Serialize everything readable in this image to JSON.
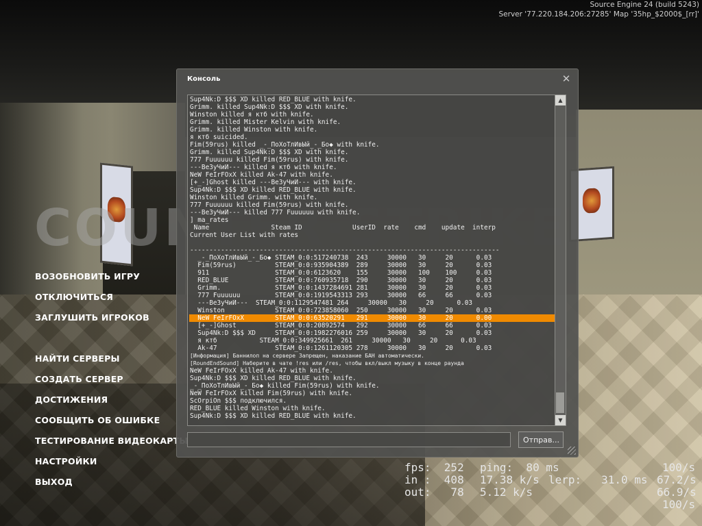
{
  "engine": {
    "version": "Source Engine 24 (build 5243)",
    "server": "Server '77.220.184.206:27285' Map '35hp_$2000$_[rr]'"
  },
  "menu": {
    "items": [
      {
        "label": "ВОЗОБНОВИТЬ ИГРУ"
      },
      {
        "label": "ОТКЛЮЧИТЬСЯ"
      },
      {
        "label": "ЗАГЛУШИТЬ ИГРОКОВ"
      },
      {
        "label": "НАЙТИ СЕРВЕРЫ"
      },
      {
        "label": "СОЗДАТЬ СЕРВЕР"
      },
      {
        "label": "ДОСТИЖЕНИЯ"
      },
      {
        "label": "СООБЩИТЬ ОБ ОШИБКЕ"
      },
      {
        "label": "ТЕСТИРОВАНИЕ ВИДЕОКАРТЫ"
      },
      {
        "label": "НАСТРОЙКИ"
      },
      {
        "label": "ВЫХОД"
      }
    ]
  },
  "console": {
    "title": "Консоль",
    "submit_label": "Отправ...",
    "input_value": "",
    "lines": [
      {
        "text": "Sup4Nk:D $$$ XD killed RED_BLUE with knife."
      },
      {
        "text": "Grimm. killed Sup4Nk:D $$$ XD with knife."
      },
      {
        "text": "Winston killed я ктб with knife."
      },
      {
        "text": "Grimm. killed Mister Kelvin with knife."
      },
      {
        "text": "Grimm. killed Winston with knife."
      },
      {
        "text": "я ктб suicided."
      },
      {
        "text": "Fim(59rus) killed _-_ПоХоТлИвЫй_-_Бо◆ with knife."
      },
      {
        "text": "Grimm. killed Sup4Nk:D $$$ XD with knife."
      },
      {
        "text": "777 Fuuuuuu killed Fim(59rus) with knife."
      },
      {
        "text": "---ВеЗуЧиЙ--- killed я ктб with knife."
      },
      {
        "text": "NeW FeIrFOxX killed Ak-47 with knife."
      },
      {
        "text": "[+_-]Ghost killed ---ВеЗуЧиЙ--- with knife."
      },
      {
        "text": "Sup4Nk:D $$$ XD killed RED_BLUE with knife."
      },
      {
        "text": "Winston killed Grimm. with knife."
      },
      {
        "text": "777 Fuuuuuu killed Fim(59rus) with knife."
      },
      {
        "text": "---ВеЗуЧиЙ--- killed 777 Fuuuuuu with knife."
      },
      {
        "text": "] ma_rates"
      },
      {
        "text": " Name                Steam ID             UserID  rate    cmd    update  interp"
      },
      {
        "text": "Current User List with rates"
      },
      {
        "text": ""
      },
      {
        "text": "--------------------------------------------------------------------------------"
      },
      {
        "text": "  _-_ПоХоТлИвЫй_-_Бо◆ STEAM_0:0:517240738  243     30000   30     20      0.03"
      },
      {
        "text": "  Fim(59rus)          STEAM_0:0:935904389  289     30000   30     20      0.03"
      },
      {
        "text": "  911                 STEAM_0:0:6123620    155     30000   100    100     0.03"
      },
      {
        "text": "  RED_BLUE            STEAM_0:0:760935718  290     30000   30     20      0.03"
      },
      {
        "text": "  Grimm.              STEAM_0:0:1437284691 281     30000   30     20      0.03"
      },
      {
        "text": "  777 Fuuuuuu         STEAM_0:0:1919543313 293     30000   66     66      0.03"
      },
      {
        "text": "  ---ВеЗуЧиЙ---  STEAM_0:0:1129547481 264     30000   30     20      0.03"
      },
      {
        "text": "  Winston             STEAM_0:0:723858060  250     30000   30     20      0.03"
      },
      {
        "text": "  NeW FeIrFOxX        STEAM_0:0:63520291   291     30000   30     20      0.00",
        "highlight": true
      },
      {
        "text": "  [+_-]Ghost          STEAM_0:0:20892574   292     30000   66     66      0.03"
      },
      {
        "text": "  Sup4Nk:D $$$ XD     STEAM_0:0:1982276016 259     30000   30     20      0.03"
      },
      {
        "text": "  я ктб           STEAM_0:0:349925661  261     30000   30     20      0.03"
      },
      {
        "text": "  Ak-47               STEAM_0:0:1261120305 278     30000   30     20      0.03"
      },
      {
        "text": "[Информация] Баннилоп на сервере Запрещен, наказание БАН автоматически.",
        "small": true
      },
      {
        "text": "[RoundEndSound] Наберите в чате !res или /res, чтобы вкл/выкл музыку в конце раунда",
        "small": true
      },
      {
        "text": "NeW FeIrFOxX killed Ak-47 with knife."
      },
      {
        "text": "Sup4Nk:D $$$ XD killed RED_BLUE with knife."
      },
      {
        "text": "_-_ПоХоТлИвЫй_-_Бо◆ killed Fim(59rus) with knife."
      },
      {
        "text": "NeW FeIrFOxX killed Fim(59rus) with knife."
      },
      {
        "text": "ScOrpiOn $$$ подключился."
      },
      {
        "text": "RED_BLUE killed Winston with knife."
      },
      {
        "text": "Sup4Nk:D $$$ XD killed RED_BLUE with knife."
      }
    ]
  },
  "netgraph": {
    "fps": "fps:  252",
    "ping": "ping:  80 ms",
    "in": "in :  408",
    "in_rate": "17.38 k/s",
    "lerp": "lerp:   31.0 ms",
    "in_pct": "67.2/s",
    "out": "out:   78",
    "out_rate": "5.12 k/s",
    "out_pct": "66.9/s",
    "rate1": "100/s",
    "rate2": "100/s"
  }
}
